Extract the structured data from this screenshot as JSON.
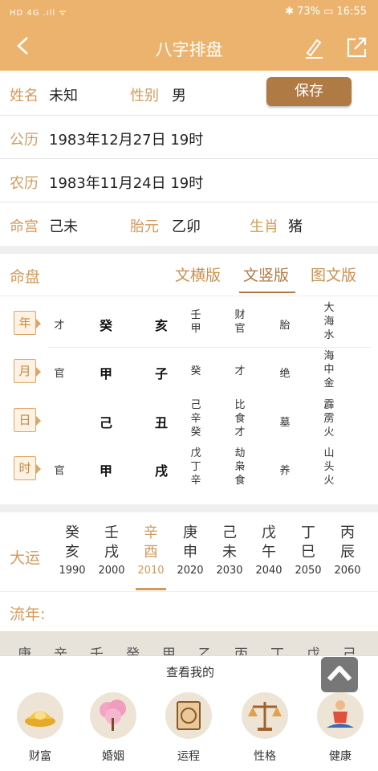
{
  "status": {
    "left": "HD 4G .ıll ᯤ",
    "right": "✱ 73% ▭ 16:55"
  },
  "header": {
    "title": "八字排盘",
    "back_icon": "chevron-left-icon",
    "edit_icon": "pencil-icon",
    "share_icon": "share-icon"
  },
  "profile": {
    "name_label": "姓名",
    "name": "未知",
    "gender_label": "性别",
    "gender": "男",
    "save": "保存",
    "solar_label": "公历",
    "solar": "1983年12月27日 19时",
    "lunar_label": "农历",
    "lunar": "1983年11月24日 19时",
    "minggong_label": "命宫",
    "minggong": "己未",
    "taiyuan_label": "胎元",
    "taiyuan": "乙卯",
    "zodiac_label": "生肖",
    "zodiac": "猪"
  },
  "chart_section": {
    "title": "命盘",
    "tabs": [
      "文横版",
      "文竖版",
      "图文版"
    ],
    "active_tab": 1
  },
  "pillars": [
    {
      "label": "年",
      "god": "才",
      "stem": "癸",
      "branch": "亥",
      "hidden": "壬甲",
      "hidden_gods": "财官",
      "stage": "胎",
      "nayin": "大海水"
    },
    {
      "label": "月",
      "god": "官",
      "stem": "甲",
      "branch": "子",
      "hidden": "癸",
      "hidden_gods": "才",
      "stage": "绝",
      "nayin": "海中金"
    },
    {
      "label": "日",
      "god": "",
      "stem": "己",
      "branch": "丑",
      "hidden": "己辛癸",
      "hidden_gods": "比食才",
      "stage": "墓",
      "nayin": "霹雳火"
    },
    {
      "label": "时",
      "god": "官",
      "stem": "甲",
      "branch": "戌",
      "hidden": "戊丁辛",
      "hidden_gods": "劫枭食",
      "stage": "养",
      "nayin": "山头火"
    }
  ],
  "dayun": {
    "label": "大运",
    "active": 2,
    "items": [
      {
        "top": "癸",
        "bottom": "亥",
        "year": "1990"
      },
      {
        "top": "壬",
        "bottom": "戌",
        "year": "2000"
      },
      {
        "top": "辛",
        "bottom": "酉",
        "year": "2010"
      },
      {
        "top": "庚",
        "bottom": "申",
        "year": "2020"
      },
      {
        "top": "己",
        "bottom": "未",
        "year": "2030"
      },
      {
        "top": "戊",
        "bottom": "午",
        "year": "2040"
      },
      {
        "top": "丁",
        "bottom": "巳",
        "year": "2050"
      },
      {
        "top": "丙",
        "bottom": "辰",
        "year": "2060"
      }
    ]
  },
  "liunian": {
    "label": "流年:",
    "peek": [
      "庚",
      "辛",
      "壬",
      "癸",
      "甲",
      "乙",
      "丙",
      "丁",
      "戊",
      "己"
    ]
  },
  "bottom": {
    "view_mine": "查看我的",
    "up_icon": "arrow-up-icon",
    "categories": [
      {
        "label": "财富",
        "icon": "gold-ingot-icon"
      },
      {
        "label": "婚姻",
        "icon": "blossom-tree-icon"
      },
      {
        "label": "运程",
        "icon": "fortune-scroll-icon"
      },
      {
        "label": "性格",
        "icon": "scales-icon"
      },
      {
        "label": "健康",
        "icon": "meditation-icon"
      }
    ]
  }
}
